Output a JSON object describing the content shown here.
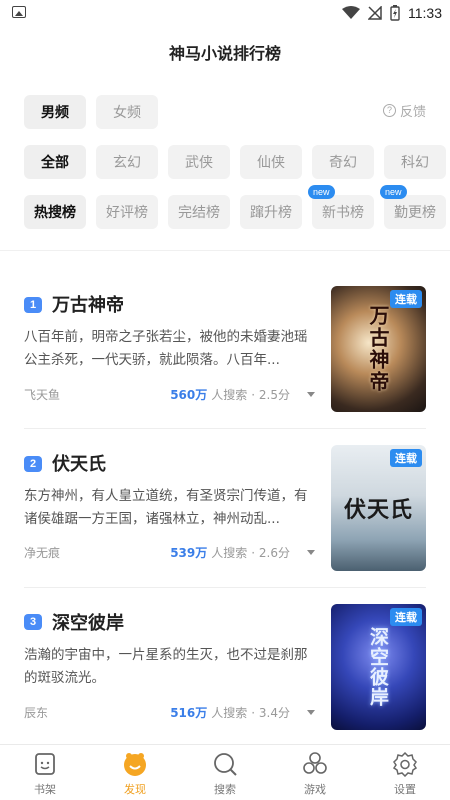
{
  "status_bar": {
    "time": "11:33"
  },
  "header": {
    "title": "神马小说排行榜"
  },
  "gender_tabs": [
    {
      "label": "男频",
      "active": true
    },
    {
      "label": "女频",
      "active": false
    }
  ],
  "feedback": {
    "label": "反馈",
    "icon": "question-icon"
  },
  "category_tabs": [
    {
      "label": "全部",
      "active": true
    },
    {
      "label": "玄幻",
      "active": false
    },
    {
      "label": "武侠",
      "active": false
    },
    {
      "label": "仙侠",
      "active": false
    },
    {
      "label": "奇幻",
      "active": false
    },
    {
      "label": "科幻",
      "active": false
    }
  ],
  "rank_tabs": [
    {
      "label": "热搜榜",
      "active": true
    },
    {
      "label": "好评榜",
      "active": false
    },
    {
      "label": "完结榜",
      "active": false
    },
    {
      "label": "蹿升榜",
      "active": false
    },
    {
      "label": "新书榜",
      "active": false,
      "badge": "new"
    },
    {
      "label": "勤更榜",
      "active": false,
      "badge": "new"
    }
  ],
  "books": [
    {
      "rank": "1",
      "title": "万古神帝",
      "desc": "八百年前，明帝之子张若尘，被他的未婚妻池瑶公主杀死，一代天骄，就此陨落。八百年...",
      "author": "飞天鱼",
      "searches": "560万",
      "search_label": "人搜索",
      "score": "· 2.5分",
      "status": "连载",
      "cover_text": "万古神帝"
    },
    {
      "rank": "2",
      "title": "伏天氏",
      "desc": "东方神州，有人皇立道统，有圣贤宗门传道，有诸侯雄踞一方王国，诸强林立，神州动乱...",
      "author": "净无痕",
      "searches": "539万",
      "search_label": "人搜索",
      "score": "· 2.6分",
      "status": "连载",
      "cover_text": "伏天氏"
    },
    {
      "rank": "3",
      "title": "深空彼岸",
      "desc": "浩瀚的宇宙中，一片星系的生灭，也不过是刹那的斑驳流光。",
      "author": "辰东",
      "searches": "516万",
      "search_label": "人搜索",
      "score": "· 3.4分",
      "status": "连载",
      "cover_text": "深空彼岸"
    }
  ],
  "bottom_tabs": [
    {
      "label": "书架",
      "icon": "bookshelf-icon",
      "active": false
    },
    {
      "label": "发现",
      "icon": "discover-icon",
      "active": true
    },
    {
      "label": "搜索",
      "icon": "search-icon",
      "active": false
    },
    {
      "label": "游戏",
      "icon": "game-icon",
      "active": false
    },
    {
      "label": "设置",
      "icon": "gear-icon",
      "active": false
    }
  ],
  "colors": {
    "accent_blue": "#2c8cf0",
    "rank_blue": "#4a8cf7",
    "active_orange": "#f0a020"
  }
}
